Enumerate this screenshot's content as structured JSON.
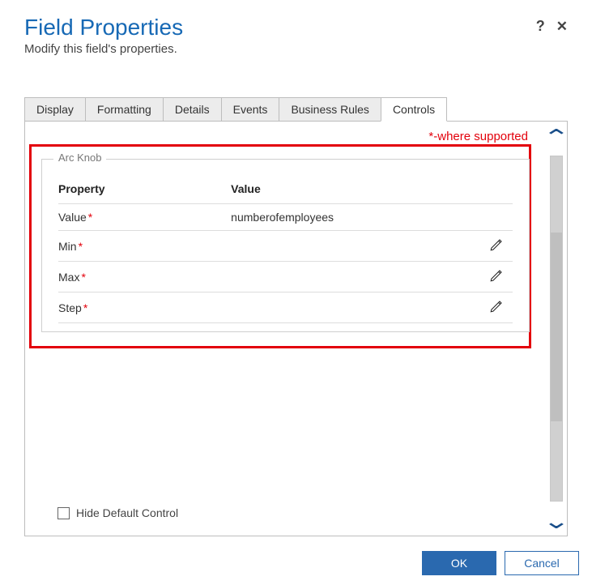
{
  "header": {
    "title": "Field Properties",
    "subtitle": "Modify this field's properties.",
    "help_icon": "?",
    "close_icon": "✕"
  },
  "tabs": {
    "items": [
      "Display",
      "Formatting",
      "Details",
      "Events",
      "Business Rules",
      "Controls"
    ],
    "active": "Controls"
  },
  "note": "*-where supported",
  "group": {
    "label": "Arc Knob",
    "columns": {
      "property": "Property",
      "value": "Value"
    },
    "rows": [
      {
        "property": "Value",
        "required": true,
        "value": "numberofemployees",
        "editable": false
      },
      {
        "property": "Min",
        "required": true,
        "value": "",
        "editable": true
      },
      {
        "property": "Max",
        "required": true,
        "value": "",
        "editable": true
      },
      {
        "property": "Step",
        "required": true,
        "value": "",
        "editable": true
      }
    ]
  },
  "hide_default_label": "Hide Default Control",
  "footer": {
    "ok": "OK",
    "cancel": "Cancel"
  },
  "required_marker": "*"
}
